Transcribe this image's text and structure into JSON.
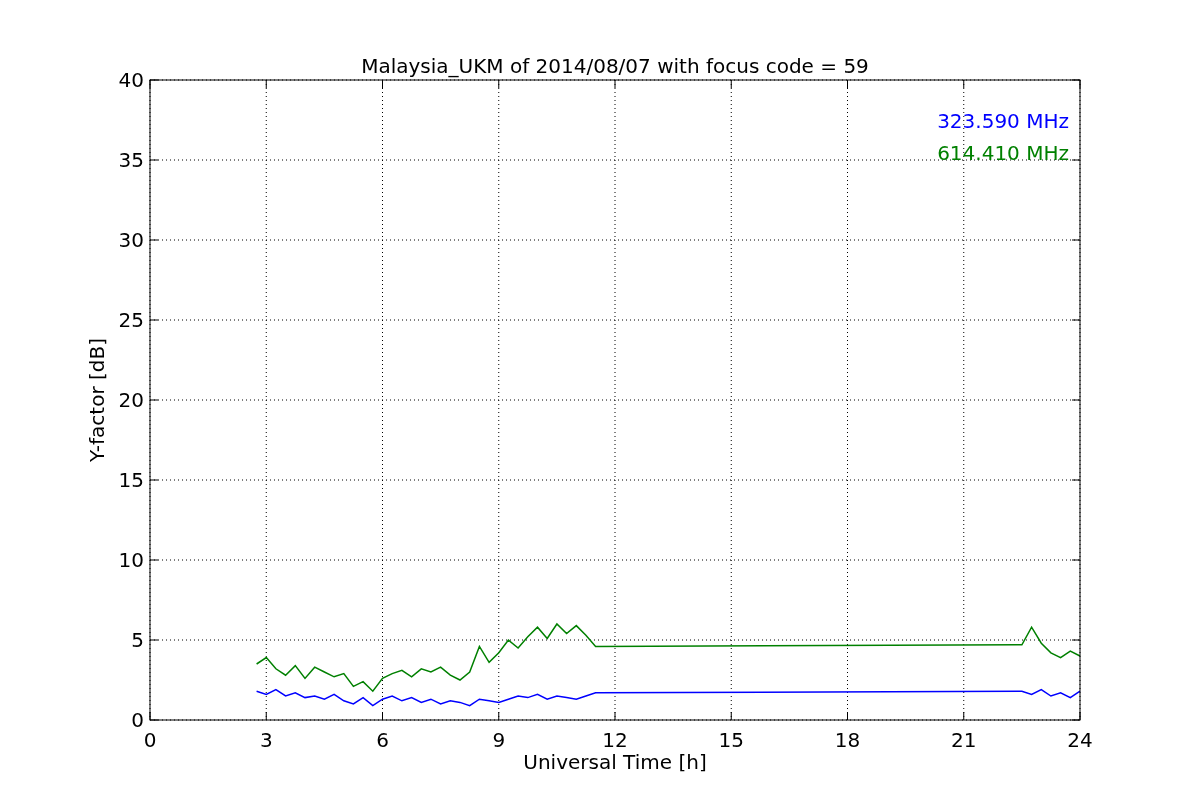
{
  "plot": {
    "chart_data": {
      "type": "line",
      "title": "Malaysia_UKM of 2014/08/07 with focus code = 59",
      "xlabel": "Universal Time [h]",
      "ylabel": "Y-factor [dB]",
      "x": [
        2.75,
        3,
        3.25,
        3.5,
        3.75,
        4,
        4.25,
        4.5,
        4.75,
        5,
        5.25,
        5.5,
        5.75,
        6,
        6.25,
        6.5,
        6.75,
        7,
        7.25,
        7.5,
        7.75,
        8,
        8.25,
        8.5,
        8.75,
        9,
        9.25,
        9.5,
        9.75,
        10,
        10.25,
        10.5,
        10.75,
        11,
        11.25,
        11.5,
        22.5,
        22.75,
        23,
        23.25,
        23.5,
        23.75,
        24
      ],
      "series": [
        {
          "name": "323.590 MHz",
          "color": "#0000ff",
          "values": [
            1.8,
            1.6,
            1.9,
            1.5,
            1.7,
            1.4,
            1.5,
            1.3,
            1.6,
            1.2,
            1.0,
            1.4,
            0.9,
            1.3,
            1.5,
            1.2,
            1.4,
            1.1,
            1.3,
            1.0,
            1.2,
            1.1,
            0.9,
            1.3,
            1.2,
            1.1,
            1.3,
            1.5,
            1.4,
            1.6,
            1.3,
            1.5,
            1.4,
            1.3,
            1.5,
            1.7,
            1.8,
            1.6,
            1.9,
            1.5,
            1.7,
            1.4,
            1.8
          ]
        },
        {
          "name": "614.410 MHz",
          "color": "#008000",
          "values": [
            3.5,
            3.9,
            3.2,
            2.8,
            3.4,
            2.6,
            3.3,
            3.0,
            2.7,
            2.9,
            2.1,
            2.4,
            1.8,
            2.6,
            2.9,
            3.1,
            2.7,
            3.2,
            3.0,
            3.3,
            2.8,
            2.5,
            3.0,
            4.6,
            3.6,
            4.2,
            5.0,
            4.5,
            5.2,
            5.8,
            5.1,
            6.0,
            5.4,
            5.9,
            5.3,
            4.6,
            4.7,
            5.8,
            4.8,
            4.2,
            3.9,
            4.3,
            4.0
          ]
        }
      ],
      "grid": true,
      "xlim": [
        0,
        24
      ],
      "ylim": [
        0,
        40
      ],
      "xticks": [
        0,
        3,
        6,
        9,
        12,
        15,
        18,
        21,
        24
      ],
      "yticks": [
        0,
        5,
        10,
        15,
        20,
        25,
        30,
        35,
        40
      ]
    }
  }
}
